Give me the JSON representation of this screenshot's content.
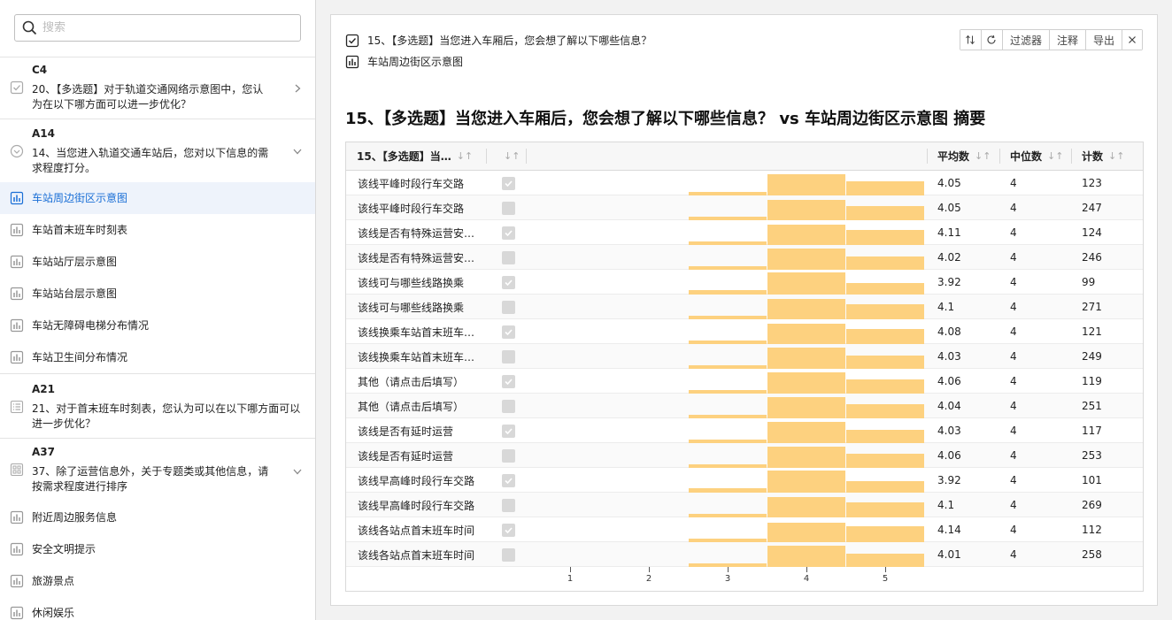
{
  "search": {
    "placeholder": "搜索"
  },
  "sidebar": {
    "questions": [
      {
        "code": "C4",
        "text": "20、【多选题】对于轨道交通网络示意图中，您认为在以下哪方面可以进一步优化？",
        "icon": "checkbox-icon",
        "chevron": "chevron-right-icon"
      },
      {
        "code": "A14",
        "text": "14、当您进入轨道交通车站后，您对以下信息的需求程度打分。",
        "icon": "rating-icon",
        "chevron": "chevron-down-icon"
      }
    ],
    "items_a14": [
      {
        "label": "车站周边街区示意图",
        "active": true
      },
      {
        "label": "车站首末班车时刻表"
      },
      {
        "label": "车站站厅层示意图"
      },
      {
        "label": "车站站台层示意图"
      },
      {
        "label": "车站无障碍电梯分布情况"
      },
      {
        "label": "车站卫生间分布情况"
      }
    ],
    "q_a21": {
      "code": "A21",
      "text": "21、对于首末班车时刻表，您认为可以在以下哪方面可以进一步优化？",
      "icon": "list-icon"
    },
    "q_a37": {
      "code": "A37",
      "text": "37、除了运营信息外，关于专题类或其他信息，请按需求程度进行排序",
      "icon": "ranking-icon",
      "chevron": "chevron-down-icon"
    },
    "items_a37": [
      {
        "label": "附近周边服务信息"
      },
      {
        "label": "安全文明提示"
      },
      {
        "label": "旅游景点"
      },
      {
        "label": "休闲娱乐"
      }
    ]
  },
  "main": {
    "crumb_question": "15、【多选题】当您进入车厢后，您会想了解以下哪些信息？",
    "crumb_item": "车站周边街区示意图",
    "toolbar": {
      "swap_icon": "swap-icon",
      "refresh_icon": "refresh-icon",
      "filter": "过滤器",
      "annotate": "注释",
      "export": "导出",
      "close_icon": "close-icon"
    },
    "title": "15、【多选题】当您进入车厢后，您会想了解以下哪些信息？ vs 车站周边街区示意图 摘要",
    "table": {
      "col_label": "15、【多选题】当…",
      "col_mean": "平均数",
      "col_median": "中位数",
      "col_count": "计数",
      "rows": [
        {
          "label": "该线平峰时段行车交路",
          "checked": true,
          "mean": "4.05",
          "median": "4",
          "count": "123",
          "dist": [
            0,
            0,
            7,
            40,
            26
          ]
        },
        {
          "label": "该线平峰时段行车交路",
          "checked": false,
          "mean": "4.05",
          "median": "4",
          "count": "247",
          "dist": [
            0,
            0,
            7,
            39,
            26
          ]
        },
        {
          "label": "该线是否有特殊运营安…",
          "checked": true,
          "mean": "4.11",
          "median": "4",
          "count": "124",
          "dist": [
            0,
            0,
            6,
            38,
            28
          ]
        },
        {
          "label": "该线是否有特殊运营安…",
          "checked": false,
          "mean": "4.02",
          "median": "4",
          "count": "246",
          "dist": [
            0,
            0,
            7,
            40,
            25
          ]
        },
        {
          "label": "该线可与哪些线路换乘",
          "checked": true,
          "mean": "3.92",
          "median": "4",
          "count": "99",
          "dist": [
            0,
            0,
            9,
            42,
            21
          ]
        },
        {
          "label": "该线可与哪些线路换乘",
          "checked": false,
          "mean": "4.1",
          "median": "4",
          "count": "271",
          "dist": [
            0,
            0,
            6,
            39,
            28
          ]
        },
        {
          "label": "该线换乘车站首末班车…",
          "checked": true,
          "mean": "4.08",
          "median": "4",
          "count": "121",
          "dist": [
            0,
            0,
            7,
            39,
            28
          ]
        },
        {
          "label": "该线换乘车站首末班车…",
          "checked": false,
          "mean": "4.03",
          "median": "4",
          "count": "249",
          "dist": [
            0,
            0,
            7,
            40,
            25
          ]
        },
        {
          "label": "其他（请点击后填写）",
          "checked": true,
          "mean": "4.06",
          "median": "4",
          "count": "119",
          "dist": [
            0,
            0,
            7,
            40,
            26
          ]
        },
        {
          "label": "其他（请点击后填写）",
          "checked": false,
          "mean": "4.04",
          "median": "4",
          "count": "251",
          "dist": [
            0,
            0,
            7,
            40,
            26
          ]
        },
        {
          "label": "该线是否有延时运营",
          "checked": true,
          "mean": "4.03",
          "median": "4",
          "count": "117",
          "dist": [
            0,
            0,
            7,
            40,
            25
          ]
        },
        {
          "label": "该线是否有延时运营",
          "checked": false,
          "mean": "4.06",
          "median": "4",
          "count": "253",
          "dist": [
            0,
            0,
            7,
            40,
            26
          ]
        },
        {
          "label": "该线早高峰时段行车交路",
          "checked": true,
          "mean": "3.92",
          "median": "4",
          "count": "101",
          "dist": [
            0,
            0,
            9,
            42,
            21
          ]
        },
        {
          "label": "该线早高峰时段行车交路",
          "checked": false,
          "mean": "4.1",
          "median": "4",
          "count": "269",
          "dist": [
            0,
            0,
            6,
            39,
            28
          ]
        },
        {
          "label": "该线各站点首末班车时间",
          "checked": true,
          "mean": "4.14",
          "median": "4",
          "count": "112",
          "dist": [
            0,
            0,
            6,
            37,
            30
          ]
        },
        {
          "label": "该线各站点首末班车时间",
          "checked": false,
          "mean": "4.01",
          "median": "4",
          "count": "258",
          "dist": [
            0,
            0,
            7,
            40,
            25
          ]
        }
      ],
      "axis_ticks": [
        "1",
        "2",
        "3",
        "4",
        "5"
      ],
      "bar_color": "#fdd17f"
    }
  },
  "colors": {
    "accent": "#1a6fd6",
    "active_bg": "#eef3fb"
  }
}
